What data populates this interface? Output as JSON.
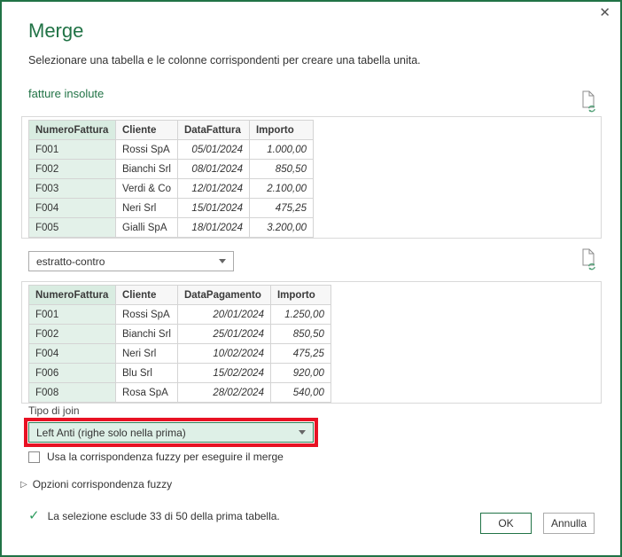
{
  "dialog": {
    "title": "Merge",
    "subtitle": "Selezionare una tabella e le colonne corrispondenti per creare una tabella unita."
  },
  "icons": {
    "close": "✕",
    "check": "✓",
    "expander": "▷",
    "refresh": "refresh-preview-document-icon"
  },
  "table1": {
    "label": "fatture insolute",
    "columns": [
      "NumeroFattura",
      "Cliente",
      "DataFattura",
      "Importo"
    ],
    "rows": [
      [
        "F001",
        "Rossi SpA",
        "05/01/2024",
        "1.000,00"
      ],
      [
        "F002",
        "Bianchi Srl",
        "08/01/2024",
        "850,50"
      ],
      [
        "F003",
        "Verdi & Co",
        "12/01/2024",
        "2.100,00"
      ],
      [
        "F004",
        "Neri Srl",
        "15/01/2024",
        "475,25"
      ],
      [
        "F005",
        "Gialli SpA",
        "18/01/2024",
        "3.200,00"
      ]
    ],
    "selected_column": "NumeroFattura"
  },
  "table2": {
    "selector_value": "estratto-contro",
    "columns": [
      "NumeroFattura",
      "Cliente",
      "DataPagamento",
      "Importo"
    ],
    "rows": [
      [
        "F001",
        "Rossi SpA",
        "20/01/2024",
        "1.250,00"
      ],
      [
        "F002",
        "Bianchi Srl",
        "25/01/2024",
        "850,50"
      ],
      [
        "F004",
        "Neri Srl",
        "10/02/2024",
        "475,25"
      ],
      [
        "F006",
        "Blu Srl",
        "15/02/2024",
        "920,00"
      ],
      [
        "F008",
        "Rosa SpA",
        "28/02/2024",
        "540,00"
      ]
    ],
    "selected_column": "NumeroFattura"
  },
  "join": {
    "label": "Tipo di join",
    "selected": "Left Anti (righe solo nella prima)"
  },
  "fuzzy": {
    "checkbox_label": "Usa la corrispondenza fuzzy per eseguire il merge",
    "checkbox_checked": false,
    "options_label": "Opzioni corrispondenza fuzzy",
    "options_expanded": false
  },
  "footer": {
    "status": "La selezione esclude 33 di 50 della prima tabella.",
    "ok_label": "OK",
    "cancel_label": "Annulla"
  },
  "colors": {
    "accent_green": "#217346",
    "selected_column_header_bg": "#d9ece1",
    "selected_column_cell_bg": "#e3f1e9",
    "annotation_red": "#e81123"
  }
}
